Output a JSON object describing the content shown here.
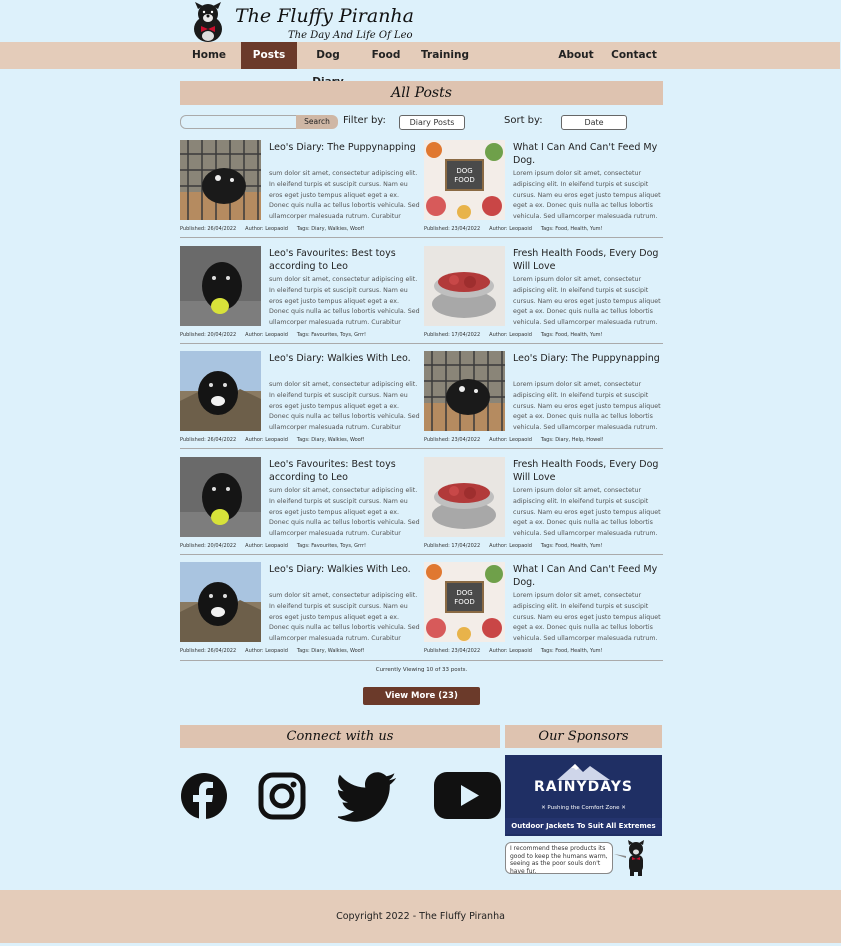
{
  "site": {
    "title": "The Fluffy Piranha",
    "tagline": "The Day And Life Of Leo"
  },
  "nav": {
    "items": [
      {
        "label": "Home",
        "active": false
      },
      {
        "label": "Posts",
        "active": true
      },
      {
        "label": "Dog Diary",
        "active": false
      },
      {
        "label": "Food",
        "active": false
      },
      {
        "label": "Training",
        "active": false
      },
      {
        "label": "About",
        "active": false
      },
      {
        "label": "Contact",
        "active": false
      }
    ]
  },
  "page": {
    "heading": "All Posts"
  },
  "toolbar": {
    "search_placeholder": "",
    "search_button": "Search",
    "filter_label": "Filter by:",
    "filter_value": "Diary Posts",
    "sort_label": "Sort by:",
    "sort_value": "Date"
  },
  "posts": [
    {
      "title": "Leo's Diary: The Puppynapping",
      "excerpt": "sum dolor sit amet, consectetur adipiscing elit. In eleifend turpis et suscipit cursus. Nam eu eros eget justo tempus aliquet eget a ex. Donec quis nulla ac tellus lobortis vehicula. Sed ullamcorper malesuada rutrum. Curabitur",
      "published": "Published: 26/04/2022",
      "author": "Author: Leopaoid",
      "tags": "Tags: Diary, Walkies, Woof!",
      "image": "puppy-in-crate"
    },
    {
      "title": "What I Can And Can't Feed My Dog.",
      "excerpt": "Lorem ipsum dolor sit amet, consectetur adipiscing elit. In eleifend turpis et suscipit cursus. Nam eu eros eget justo tempus aliquet eget a ex. Donec quis nulla ac tellus lobortis vehicula. Sed ullamcorper malesuada rutrum.",
      "published": "Published: 23/04/2022",
      "author": "Author: Leopaoid",
      "tags": "Tags: Food, Health, Yum!",
      "image": "dog-food-board"
    },
    {
      "title": "Leo's Favourites: Best toys according to Leo",
      "excerpt": "sum dolor sit amet, consectetur adipiscing elit. In eleifend turpis et suscipit cursus. Nam eu eros eget justo tempus aliquet eget a ex. Donec quis nulla ac tellus lobortis vehicula. Sed ullamcorper malesuada rutrum. Curabitur",
      "published": "Published: 20/04/2022",
      "author": "Author: Leopaoid",
      "tags": "Tags: Favourites, Toys, Grrr!",
      "image": "puppy-with-ball"
    },
    {
      "title": "Fresh Health Foods, Every Dog Will Love",
      "excerpt": "Lorem ipsum dolor sit amet, consectetur adipiscing elit. In eleifend turpis et suscipit cursus. Nam eu eros eget justo tempus aliquet eget a ex. Donec quis nulla ac tellus lobortis vehicula. Sed ullamcorper malesuada rutrum.",
      "published": "Published: 17/04/2022",
      "author": "Author: Leopaoid",
      "tags": "Tags: Food, Health, Yum!",
      "image": "meat-bowl"
    },
    {
      "title": "Leo's Diary: Walkies With Leo.",
      "excerpt": "sum dolor sit amet, consectetur adipiscing elit. In eleifend turpis et suscipit cursus. Nam eu eros eget justo tempus aliquet eget a ex. Donec quis nulla ac tellus lobortis vehicula. Sed ullamcorper malesuada rutrum. Curabitur",
      "published": "Published: 26/04/2022",
      "author": "Author: Leopaoid",
      "tags": "Tags: Diary, Walkies, Woof!",
      "image": "puppy-on-rocks"
    },
    {
      "title": "Leo's Diary: The Puppynapping",
      "excerpt": "Lorem ipsum dolor sit amet, consectetur adipiscing elit. In eleifend turpis et suscipit cursus. Nam eu eros eget justo tempus aliquet eget a ex. Donec quis nulla ac tellus lobortis vehicula. Sed ullamcorper malesuada rutrum.",
      "published": "Published: 23/04/2022",
      "author": "Author: Leopaoid",
      "tags": "Tags: Diary, Help, Howel!",
      "image": "puppy-in-crate"
    },
    {
      "title": "Leo's Favourites: Best toys according to Leo",
      "excerpt": "sum dolor sit amet, consectetur adipiscing elit. In eleifend turpis et suscipit cursus. Nam eu eros eget justo tempus aliquet eget a ex. Donec quis nulla ac tellus lobortis vehicula. Sed ullamcorper malesuada rutrum. Curabitur",
      "published": "Published: 20/04/2022",
      "author": "Author: Leopaoid",
      "tags": "Tags: Favourites, Toys, Grrr!",
      "image": "puppy-with-ball"
    },
    {
      "title": "Fresh Health Foods, Every Dog Will Love",
      "excerpt": "Lorem ipsum dolor sit amet, consectetur adipiscing elit. In eleifend turpis et suscipit cursus. Nam eu eros eget justo tempus aliquet eget a ex. Donec quis nulla ac tellus lobortis vehicula. Sed ullamcorper malesuada rutrum.",
      "published": "Published: 17/04/2022",
      "author": "Author: Leopaoid",
      "tags": "Tags: Food, Health, Yum!",
      "image": "meat-bowl"
    },
    {
      "title": "Leo's Diary: Walkies With Leo.",
      "excerpt": "sum dolor sit amet, consectetur adipiscing elit. In eleifend turpis et suscipit cursus. Nam eu eros eget justo tempus aliquet eget a ex. Donec quis nulla ac tellus lobortis vehicula. Sed ullamcorper malesuada rutrum. Curabitur",
      "published": "Published: 26/04/2022",
      "author": "Author: Leopaoid",
      "tags": "Tags: Diary, Walkies, Woof!",
      "image": "puppy-on-rocks"
    },
    {
      "title": "What I Can And Can't Feed My Dog.",
      "excerpt": "Lorem ipsum dolor sit amet, consectetur adipiscing elit. In eleifend turpis et suscipit cursus. Nam eu eros eget justo tempus aliquet eget a ex. Donec quis nulla ac tellus lobortis vehicula. Sed ullamcorper malesuada rutrum.",
      "published": "Published: 23/04/2022",
      "author": "Author: Leopaoid",
      "tags": "Tags: Food, Health, Yum!",
      "image": "dog-food-board"
    }
  ],
  "food_board_text": "DOG FOOD",
  "status_text": "Currently Viewing 10 of 33 posts.",
  "view_more": "View More (23)",
  "connect": {
    "heading": "Connect with us",
    "icons": [
      "facebook-icon",
      "instagram-icon",
      "twitter-icon",
      "youtube-icon"
    ]
  },
  "sponsors": {
    "heading": "Our Sponsors",
    "brand": "RAINYDAYS",
    "slogan": "✕ Pushing the Comfort Zone ✕",
    "bar": "Outdoor Jackets To Suit All Extremes",
    "bubble": "I recommend these products its good to keep the humans warm, seeing as the poor souls don't have fur."
  },
  "footer": {
    "copyright": "Copyright 2022 - The Fluffy Piranha"
  },
  "colors": {
    "background": "#ddf1fb",
    "nav": "#e4ccba",
    "accent": "#6b3a2a",
    "banner": "#dec3b0",
    "sponsor": "#1f2f64"
  }
}
